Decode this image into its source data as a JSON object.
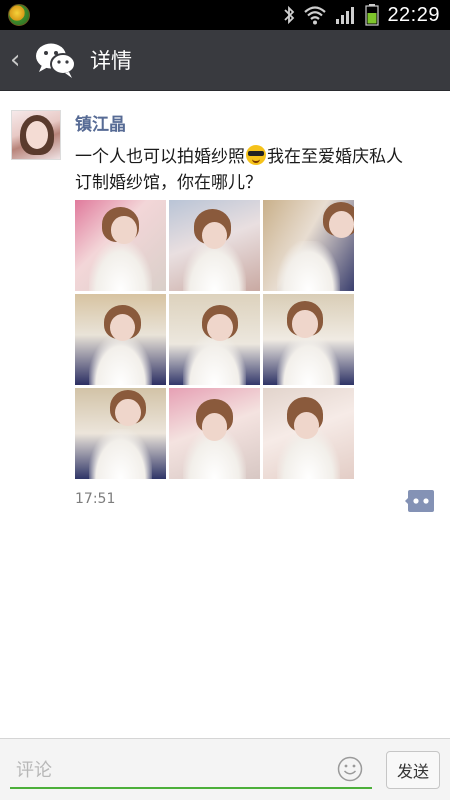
{
  "status_bar": {
    "time": "22:29",
    "icons": [
      "app-badge-icon",
      "bluetooth-icon",
      "wifi-icon",
      "signal-icon",
      "battery-icon"
    ]
  },
  "header": {
    "back_icon": "‹",
    "logo_icon": "wechat-icon",
    "title": "详情"
  },
  "post": {
    "author": "镇江晶",
    "text_part1": "一个人也可以拍婚纱照",
    "emoji": "cool-sunglasses-emoji",
    "text_part2": "我在至爱婚庆私人订制婚纱馆，你在哪儿？",
    "photos": [
      {
        "bg": "linear-gradient(135deg,#e07a9c 0%,#f3d6d8 40%,#d9cfc9 100%)"
      },
      {
        "bg": "linear-gradient(160deg,#b9c4d6 0%,#e9dfe0 45%,#c9a9a2 100%)"
      },
      {
        "bg": "linear-gradient(120deg,#c9b08a 0%,#e8ddd1 45%,#3a3f6e 100%)"
      },
      {
        "bg": "linear-gradient(180deg,#d7c3a1 0%,#e9e3d8 45%,#2c2f63 100%)"
      },
      {
        "bg": "linear-gradient(180deg,#ddd2bd 0%,#ece7de 55%,#33386b 100%)"
      },
      {
        "bg": "linear-gradient(180deg,#d9cdb6 0%,#f0ebe3 50%,#2f3466 100%)"
      },
      {
        "bg": "linear-gradient(180deg,#d2c3a7 0%,#ece5db 50%,#2f3567 100%)"
      },
      {
        "bg": "linear-gradient(160deg,#e6a0b4 0%,#f4e3e0 45%,#d7c7c3 100%)"
      },
      {
        "bg": "linear-gradient(160deg,#e2d4cc 0%,#f6ebe7 45%,#e3cdc6 100%)"
      }
    ],
    "time": "17:51",
    "comment_icon": "comment-bubble-icon"
  },
  "comment_bar": {
    "placeholder": "评论",
    "smiley_icon": "smiley-icon",
    "send_label": "发送"
  },
  "colors": {
    "title_bar": "#393a3f",
    "author_link": "#576b95",
    "input_underline": "#4caf3a"
  }
}
